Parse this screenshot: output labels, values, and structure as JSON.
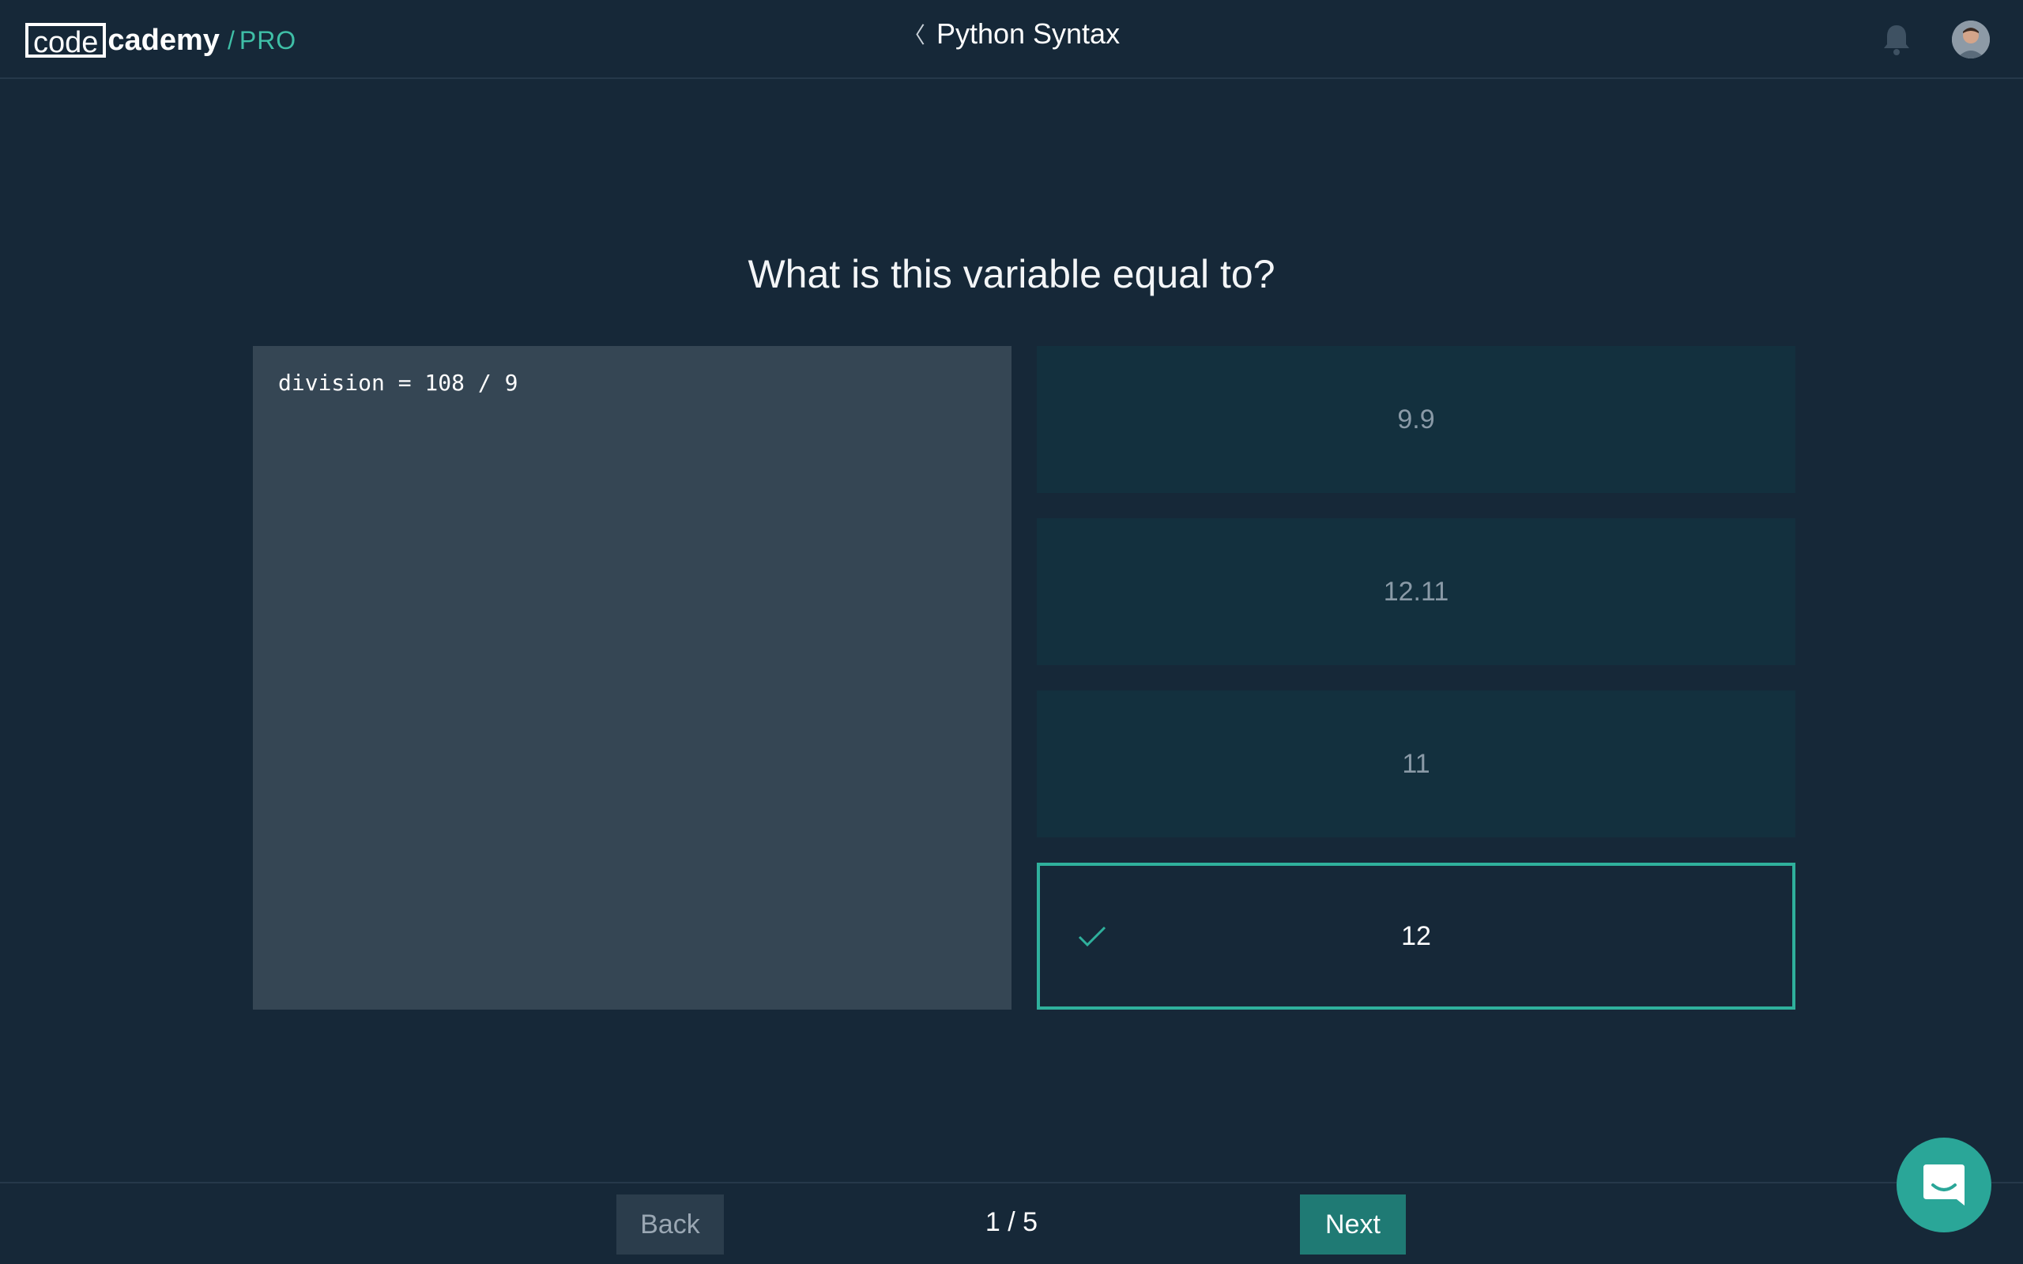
{
  "header": {
    "logo": {
      "part1": "code",
      "part2": "cademy",
      "slash": "/",
      "pro": "PRO"
    },
    "course_title": "Python Syntax",
    "back_icon": "chevron-left-icon",
    "bell_icon": "bell-icon",
    "avatar_icon": "user-avatar"
  },
  "question": {
    "text": "What is this variable equal to?",
    "code": "division = 108 / 9"
  },
  "answers": [
    {
      "label": "9.9",
      "selected": false
    },
    {
      "label": "12.11",
      "selected": false
    },
    {
      "label": "11",
      "selected": false
    },
    {
      "label": "12",
      "selected": true
    }
  ],
  "footer": {
    "back_label": "Back",
    "progress": "1 / 5",
    "next_label": "Next"
  },
  "colors": {
    "background": "#162838",
    "accent": "#2fb09c",
    "answer_bg": "#13303e",
    "code_bg": "#354654",
    "next_bg": "#1f7a74"
  },
  "chat_icon": "chat-bubble-icon"
}
